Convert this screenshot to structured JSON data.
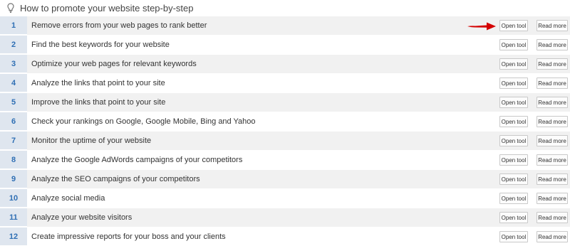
{
  "header": {
    "title": "How to promote your website step-by-step",
    "icon": "lightbulb-icon"
  },
  "buttons": {
    "open_label": "Open tool",
    "more_label": "Read more"
  },
  "steps": [
    {
      "num": "1",
      "label": "Remove errors from your web pages to rank better"
    },
    {
      "num": "2",
      "label": "Find the best keywords for your website"
    },
    {
      "num": "3",
      "label": "Optimize your web pages for relevant keywords"
    },
    {
      "num": "4",
      "label": "Analyze the links that point to your site"
    },
    {
      "num": "5",
      "label": "Improve the links that point to your site"
    },
    {
      "num": "6",
      "label": "Check your rankings on Google, Google Mobile, Bing and Yahoo"
    },
    {
      "num": "7",
      "label": "Monitor the uptime of your website"
    },
    {
      "num": "8",
      "label": "Analyze the Google AdWords campaigns of your competitors"
    },
    {
      "num": "9",
      "label": "Analyze the SEO campaigns of your competitors"
    },
    {
      "num": "10",
      "label": "Analyze social media"
    },
    {
      "num": "11",
      "label": "Analyze your website visitors"
    },
    {
      "num": "12",
      "label": "Create impressive reports for your boss and your clients"
    }
  ],
  "colors": {
    "number_text": "#2f6fb4",
    "number_bg": "#dfe6ef",
    "arrow": "#d40000"
  }
}
